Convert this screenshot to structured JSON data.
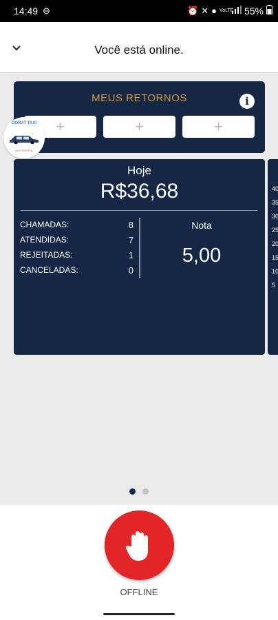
{
  "status": {
    "time": "14:49",
    "right_small": "VoLTE",
    "battery": "55%"
  },
  "header": {
    "title": "Você está online."
  },
  "logo": {
    "top_text": "DORAT TAXI",
    "bottom_text": "MOTORISTA"
  },
  "returns": {
    "title": "MEUS RETORNOS",
    "info_glyph": "i",
    "slots": [
      "+",
      "+",
      "+"
    ]
  },
  "stats": {
    "today_label": "Hoje",
    "today_value": "R$36,68",
    "rows": [
      {
        "label": "CHAMADAS:",
        "value": "8"
      },
      {
        "label": "ATENDIDAS:",
        "value": "7"
      },
      {
        "label": "REJEITADAS:",
        "value": "1"
      },
      {
        "label": "CANCELADAS:",
        "value": "0"
      }
    ],
    "rating_label": "Nota",
    "rating_value": "5,00"
  },
  "peek_ticks": [
    "40",
    "35",
    "30",
    "25",
    "20",
    "15",
    "10",
    "5"
  ],
  "pager": {
    "count": 2,
    "active": 1
  },
  "offline": {
    "label": "OFFLINE",
    "color": "#e32527"
  },
  "colors": {
    "card": "#152745",
    "accent": "#d49a3c"
  }
}
